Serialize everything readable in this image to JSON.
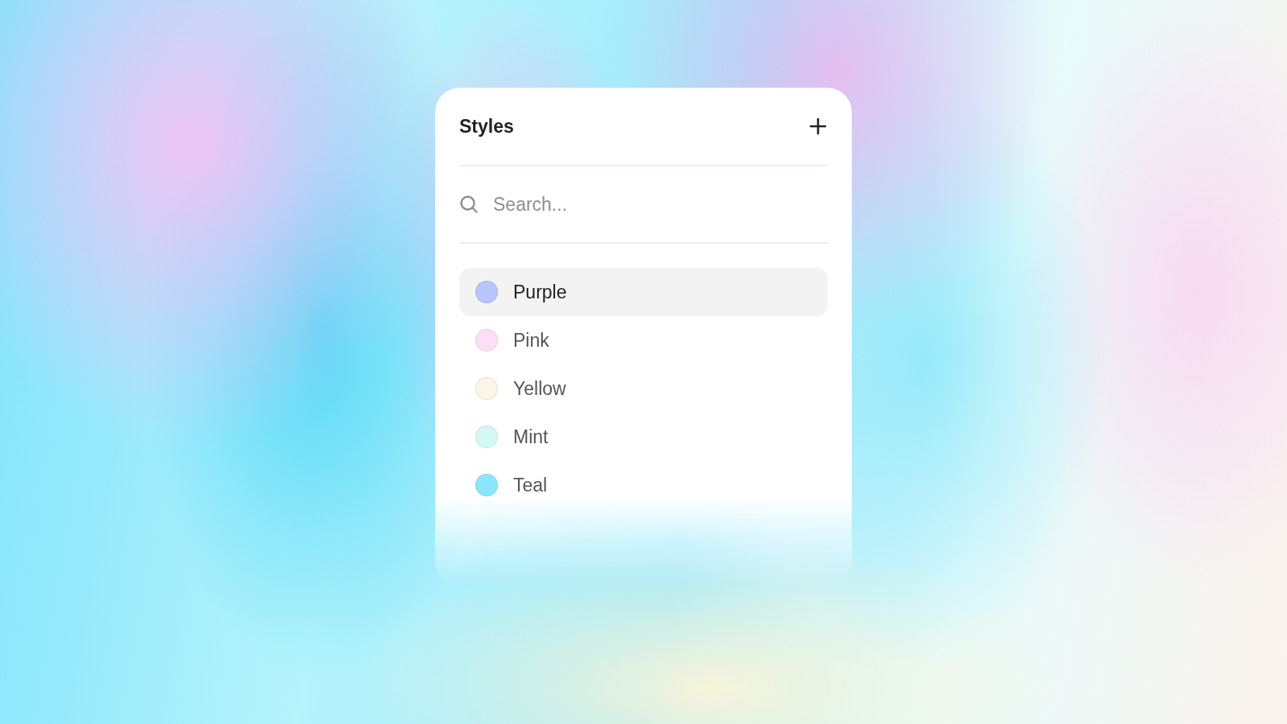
{
  "panel": {
    "title": "Styles",
    "search": {
      "placeholder": "Search..."
    },
    "items": [
      {
        "kind": "style",
        "label": "Purple",
        "color": "#b8c4fb",
        "selected": true
      },
      {
        "kind": "style",
        "label": "Pink",
        "color": "#fbdff5",
        "selected": false
      },
      {
        "kind": "style",
        "label": "Yellow",
        "color": "#fbf6e8",
        "selected": false
      },
      {
        "kind": "style",
        "label": "Mint",
        "color": "#d4f8f6",
        "selected": false
      },
      {
        "kind": "style",
        "label": "Teal",
        "color": "#8ce6fb",
        "selected": false
      }
    ]
  }
}
